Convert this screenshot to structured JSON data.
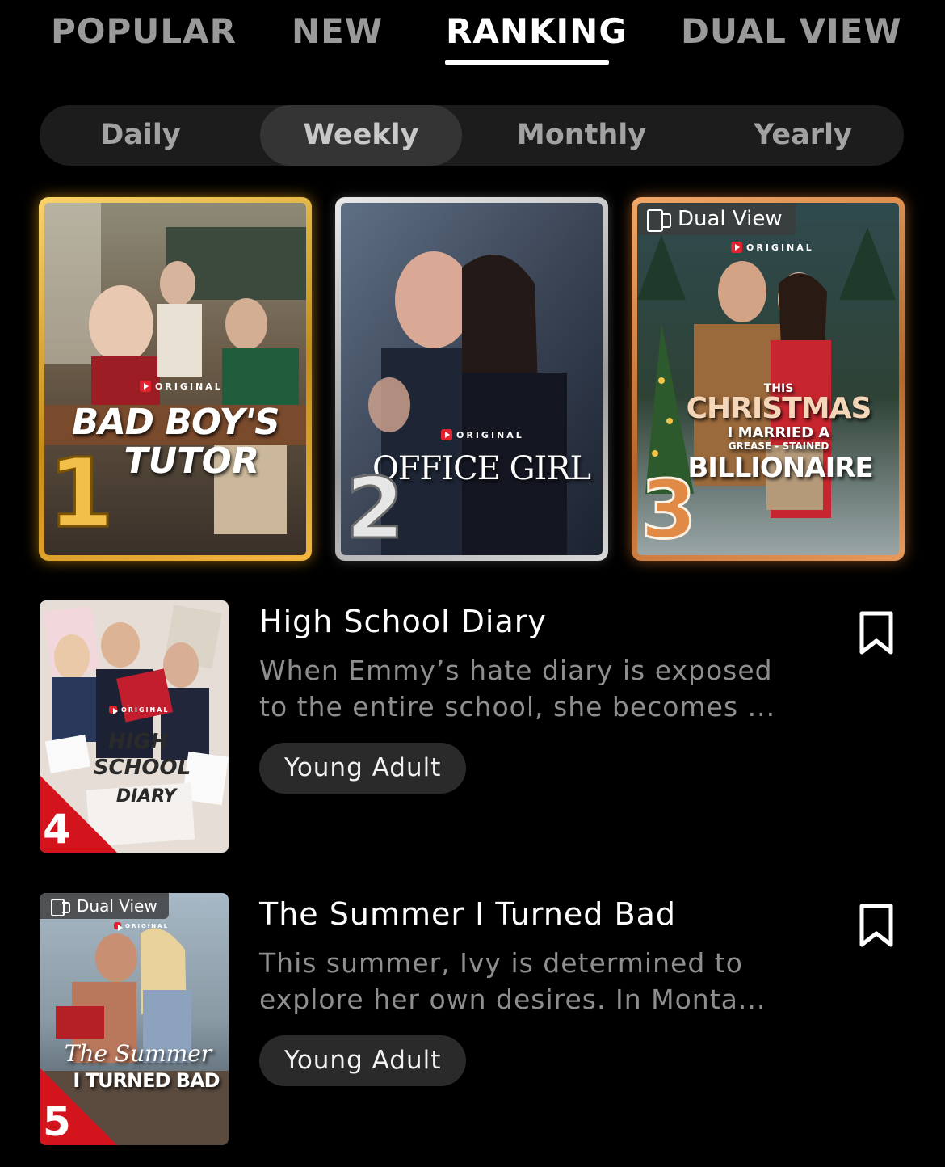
{
  "tabs": [
    {
      "label": "POPULAR",
      "active": false
    },
    {
      "label": "NEW",
      "active": false
    },
    {
      "label": "RANKING",
      "active": true
    },
    {
      "label": "DUAL VIEW",
      "active": false
    }
  ],
  "periods": [
    {
      "label": "Daily",
      "active": false
    },
    {
      "label": "Weekly",
      "active": true
    },
    {
      "label": "Monthly",
      "active": false
    },
    {
      "label": "Yearly",
      "active": false
    }
  ],
  "top3": [
    {
      "rank": "1",
      "title_line1": "BAD BOY'S",
      "title_line2": "TUTOR",
      "original_label": "ORIGINAL",
      "medal": "gold",
      "dual_view": false
    },
    {
      "rank": "2",
      "title_line1": "OFFICE GIRL",
      "original_label": "ORIGINAL",
      "medal": "silver",
      "dual_view": false
    },
    {
      "rank": "3",
      "title_small": "THIS",
      "title_line1": "CHRISTMAS",
      "title_line2": "I MARRIED A",
      "title_line3": "GREASE - STAINED",
      "title_line4": "BILLIONAIRE",
      "original_label": "ORIGINAL",
      "medal": "bronze",
      "dual_view": true,
      "dual_label": "Dual View"
    }
  ],
  "list": [
    {
      "rank": "4",
      "title": "High School Diary",
      "desc_line1": "When Emmy’s hate diary is exposed",
      "desc_line2": "to the entire school, she becomes ...",
      "genre": "Young Adult",
      "poster_line1": "HIGH",
      "poster_line2": "SCHOOL",
      "poster_line3": "DIARY",
      "original_label": "ORIGINAL",
      "dual_view": false
    },
    {
      "rank": "5",
      "title": "The Summer I Turned Bad",
      "desc_line1": "This summer, Ivy is determined to",
      "desc_line2": "explore her own desires. In Monta...",
      "genre": "Young Adult",
      "poster_line1": "The Summer",
      "poster_line2": "I TURNED BAD",
      "original_label": "ORIGINAL",
      "dual_view": true,
      "dual_label": "Dual View"
    }
  ],
  "icons": {
    "bookmark": "bookmark-outline-icon",
    "dual_view": "dual-view-icon",
    "original": "play-logo-icon"
  },
  "colors": {
    "background": "#000000",
    "gold": "#e0a526",
    "silver": "#c4c4c4",
    "bronze": "#d9813e",
    "rank_corner": "#d4141d"
  }
}
